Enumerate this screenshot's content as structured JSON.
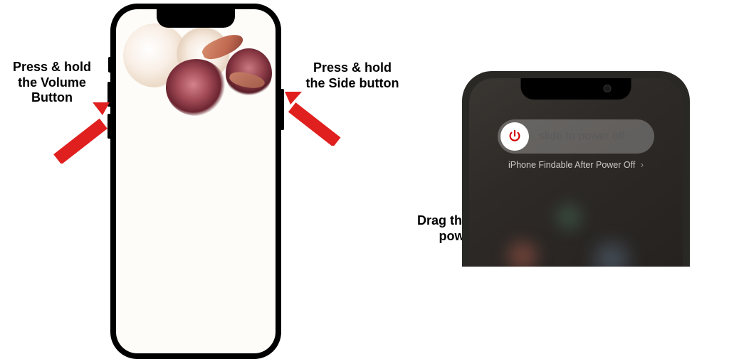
{
  "labels": {
    "volume": "Press & hold the Volume Button",
    "side": "Press & hold the Side button",
    "drag": "Drag the slider to power offf"
  },
  "slider": {
    "text": "slide to power off",
    "findable": "iPhone Findable After Power Off"
  },
  "colors": {
    "arrow": "#e01f1f",
    "power_icon": "#d40000"
  }
}
